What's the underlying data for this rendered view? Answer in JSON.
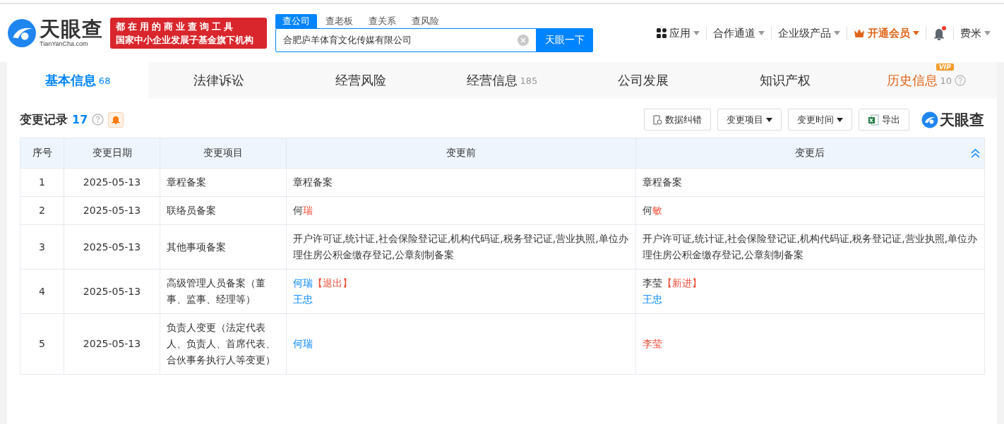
{
  "header": {
    "logo_text": "天眼查",
    "logo_domain": "TianYanCha.com",
    "slogan_line_1": "都在用的商业查询工具",
    "slogan_line_2": "国家中小企业发展子基金旗下机构",
    "search_tabs": [
      {
        "label": "查公司",
        "selected": true
      },
      {
        "label": "查老板",
        "selected": false
      },
      {
        "label": "查关系",
        "selected": false
      },
      {
        "label": "查风险",
        "selected": false
      }
    ],
    "search_value": "合肥庐羊体育文化传媒有限公司",
    "search_button": "天眼一下",
    "nav": [
      {
        "label": "应用",
        "kind": "apps"
      },
      {
        "label": "合作通道",
        "kind": "plain"
      },
      {
        "label": "企业级产品",
        "kind": "plain"
      },
      {
        "label": "开通会员",
        "kind": "vip"
      },
      {
        "kind": "bell"
      },
      {
        "label": "费米",
        "kind": "plain"
      }
    ]
  },
  "tabs": [
    {
      "label": "基本信息",
      "count": "68",
      "selected": true,
      "kind": "plain"
    },
    {
      "label": "法律诉讼",
      "selected": false,
      "kind": "plain"
    },
    {
      "label": "经营风险",
      "selected": false,
      "kind": "plain"
    },
    {
      "label": "经营信息",
      "count": "185",
      "selected": false,
      "kind": "plain"
    },
    {
      "label": "公司发展",
      "selected": false,
      "kind": "plain"
    },
    {
      "label": "知识产权",
      "selected": false,
      "kind": "plain"
    },
    {
      "label": "历史信息",
      "count": "10",
      "badge": "VIP",
      "selected": false,
      "kind": "history"
    }
  ],
  "section": {
    "title": "变更记录",
    "count": "17",
    "buttons": [
      {
        "label": "数据纠错",
        "kind": "report"
      },
      {
        "label": "变更项目",
        "kind": "dropdown"
      },
      {
        "label": "变更时间",
        "kind": "dropdown"
      },
      {
        "label": "导出",
        "kind": "export"
      }
    ],
    "brand": "天眼查"
  },
  "table": {
    "columns": [
      "序号",
      "变更日期",
      "变更项目",
      "变更前",
      "变更后"
    ],
    "rows": [
      {
        "index": "1",
        "date": "2025-05-13",
        "item": "章程备案",
        "before": [
          [
            {
              "text": "章程备案",
              "kind": "plain"
            }
          ]
        ],
        "after": [
          [
            {
              "text": "章程备案",
              "kind": "plain"
            }
          ]
        ]
      },
      {
        "index": "2",
        "date": "2025-05-13",
        "item": "联络员备案",
        "before": [
          [
            {
              "text": "何",
              "kind": "plain"
            },
            {
              "text": "瑞",
              "kind": "changed"
            }
          ]
        ],
        "after": [
          [
            {
              "text": "何",
              "kind": "plain"
            },
            {
              "text": "敏",
              "kind": "changed"
            }
          ]
        ]
      },
      {
        "index": "3",
        "date": "2025-05-13",
        "item": "其他事项备案",
        "before": [
          [
            {
              "text": "开户许可证,统计证,社会保险登记证,机构代码证,税务登记证,营业执照,单位办理住房公积金缴存登记,公章刻制备案",
              "kind": "plain"
            }
          ]
        ],
        "after": [
          [
            {
              "text": "开户许可证,统计证,社会保险登记证,机构代码证,税务登记证,营业执照,单位办理住房公积金缴存登记,公章刻制备案",
              "kind": "plain"
            }
          ]
        ]
      },
      {
        "index": "4",
        "date": "2025-05-13",
        "item": "高级管理人员备案（董事、监事、经理等）",
        "before": [
          [
            {
              "text": "何瑞",
              "kind": "link"
            },
            {
              "text": "【退出】",
              "kind": "changed"
            }
          ],
          [
            {
              "text": "王忠",
              "kind": "link"
            }
          ]
        ],
        "after": [
          [
            {
              "text": "李莹",
              "kind": "plain"
            },
            {
              "text": "【新进】",
              "kind": "changed"
            }
          ],
          [
            {
              "text": "王忠",
              "kind": "link"
            }
          ]
        ]
      },
      {
        "index": "5",
        "date": "2025-05-13",
        "item": "负责人变更（法定代表人、负责人、首席代表、合伙事务执行人等变更）",
        "before": [
          [
            {
              "text": "何瑞",
              "kind": "link"
            }
          ]
        ],
        "after": [
          [
            {
              "text": "李莹",
              "kind": "changed"
            }
          ]
        ]
      }
    ]
  }
}
